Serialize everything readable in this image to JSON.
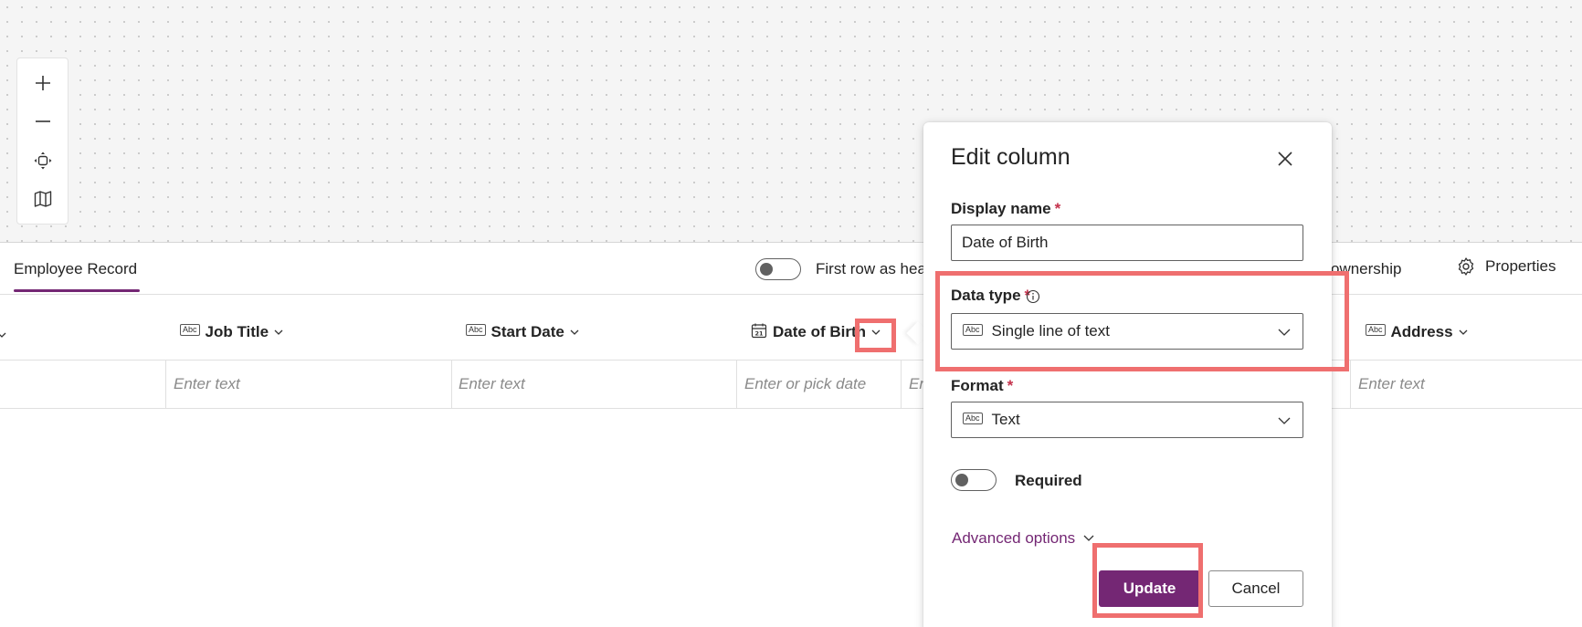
{
  "canvas": {
    "toolbar": {
      "icons": [
        "plus-icon",
        "minus-icon",
        "fit-view-icon",
        "map-icon"
      ]
    }
  },
  "header": {
    "active_tab": "Employee Record",
    "first_row_label": "First row as hea",
    "ownership_label": "w ownership",
    "properties_label": "Properties"
  },
  "table": {
    "columns": [
      {
        "label": "Job Title",
        "icon": "abc-icon"
      },
      {
        "label": "Start Date",
        "icon": "abc-icon"
      },
      {
        "label": "Date of Birth",
        "icon": "calendar-icon"
      },
      {
        "label": "Address",
        "icon": "abc-icon"
      }
    ],
    "placeholders": {
      "job_title": "Enter text",
      "start_date": "Enter text",
      "date_of_birth": "Enter or pick date",
      "partial": "En",
      "address": "Enter text"
    }
  },
  "edit_column": {
    "title": "Edit column",
    "display_name_label": "Display name",
    "required_mark": "*",
    "display_name_value": "Date of Birth",
    "data_type_label": "Data type",
    "data_type_value": "Single line of text",
    "format_label": "Format",
    "format_value": "Text",
    "required_label": "Required",
    "required_on": false,
    "advanced_options_label": "Advanced options",
    "update_label": "Update",
    "cancel_label": "Cancel",
    "abc_icon_text": "Abc"
  },
  "colors": {
    "accent": "#742774",
    "highlight": "#ef6f6f",
    "required": "#c4314b"
  }
}
